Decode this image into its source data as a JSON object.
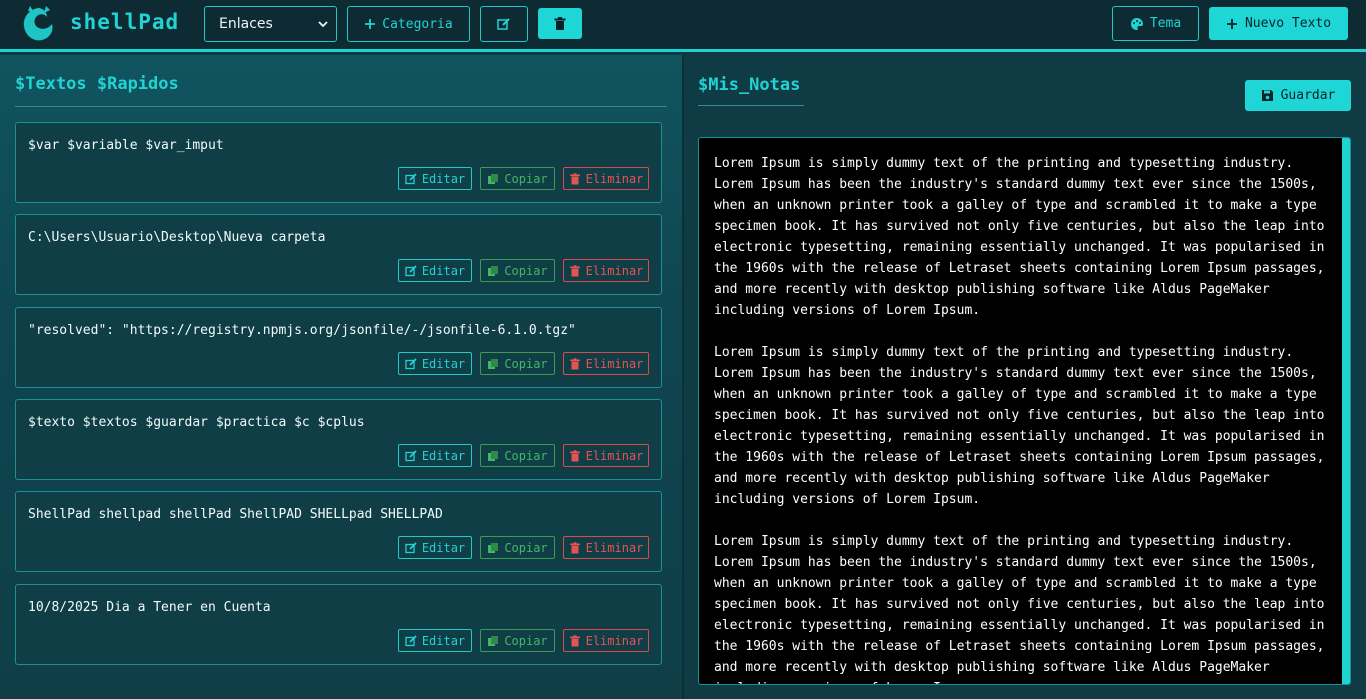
{
  "header": {
    "brand": "shellPad",
    "category_select": {
      "value": "Enlaces"
    },
    "category_button": "Categoria",
    "theme_button": "Tema",
    "new_text_button": "Nuevo Texto"
  },
  "left": {
    "title": "$Textos $Rapidos",
    "cards": [
      {
        "text": "$var $variable $var_imput"
      },
      {
        "text": "C:\\Users\\Usuario\\Desktop\\Nueva carpeta"
      },
      {
        "text": "\"resolved\": \"https://registry.npmjs.org/jsonfile/-/jsonfile-6.1.0.tgz\""
      },
      {
        "text": "$texto $textos $guardar $practica $c $cplus"
      },
      {
        "text": "ShellPad shellpad shellPad ShellPAD SHELLpad SHELLPAD"
      },
      {
        "text": "10/8/2025 Dia a Tener en Cuenta"
      }
    ],
    "labels": {
      "edit": "Editar",
      "copy": "Copiar",
      "delete": "Eliminar"
    }
  },
  "right": {
    "title": "$Mis_Notas",
    "save_button": "Guardar",
    "notes": "Lorem Ipsum is simply dummy text of the printing and typesetting industry.\nLorem Ipsum has been the industry's standard dummy text ever since the 1500s,\nwhen an unknown printer took a galley of type and scrambled it to make a type\nspecimen book. It has survived not only five centuries, but also the leap into\nelectronic typesetting, remaining essentially unchanged. It was popularised in\nthe 1960s with the release of Letraset sheets containing Lorem Ipsum passages,\nand more recently with desktop publishing software like Aldus PageMaker\nincluding versions of Lorem Ipsum.\n\nLorem Ipsum is simply dummy text of the printing and typesetting industry.\nLorem Ipsum has been the industry's standard dummy text ever since the 1500s,\nwhen an unknown printer took a galley of type and scrambled it to make a type\nspecimen book. It has survived not only five centuries, but also the leap into\nelectronic typesetting, remaining essentially unchanged. It was popularised in\nthe 1960s with the release of Letraset sheets containing Lorem Ipsum passages,\nand more recently with desktop publishing software like Aldus PageMaker\nincluding versions of Lorem Ipsum.\n\nLorem Ipsum is simply dummy text of the printing and typesetting industry.\nLorem Ipsum has been the industry's standard dummy text ever since the 1500s,\nwhen an unknown printer took a galley of type and scrambled it to make a type\nspecimen book. It has survived not only five centuries, but also the leap into\nelectronic typesetting, remaining essentially unchanged. It was popularised in\nthe 1960s with the release of Letraset sheets containing Lorem Ipsum passages,\nand more recently with desktop publishing software like Aldus PageMaker\nincluding versions of Lorem Ipsum."
  },
  "colors": {
    "accent": "#1fd6d6",
    "header_bg": "#0e2b33",
    "panel_bg": "#0f3e47",
    "copy_green": "#42b763",
    "delete_red": "#e55353"
  },
  "icons": {
    "logo": "dragon-logo-icon",
    "category_add": "plus-icon",
    "edit": "edit-icon",
    "delete": "trash-icon",
    "theme": "palette-icon",
    "new_text": "plus-icon",
    "save": "floppy-disk-icon",
    "copy": "copy-icon"
  }
}
